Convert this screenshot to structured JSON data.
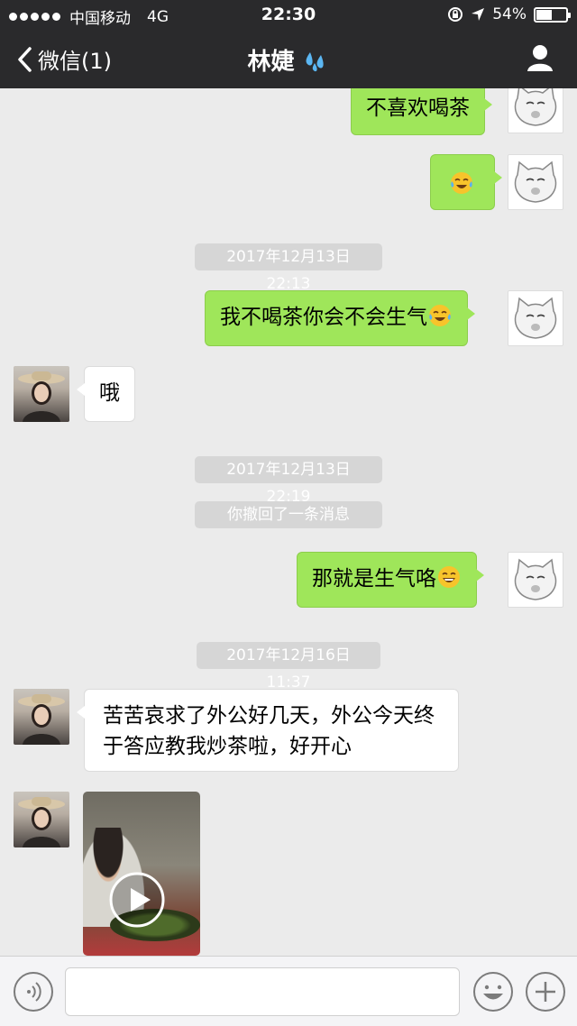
{
  "status_bar": {
    "carrier": "中国移动",
    "network": "4G",
    "time": "22:30",
    "battery": "54%",
    "battery_level": 0.54
  },
  "nav": {
    "back_label": "微信(1)",
    "title": "林婕",
    "title_emoji": "sweat-droplets-icon"
  },
  "messages": [
    {
      "type": "text",
      "from": "me",
      "text": "不喜欢喝茶"
    },
    {
      "type": "emoji",
      "from": "me",
      "emoji": "tears-of-joy-emoji"
    },
    {
      "type": "timestamp",
      "text": "2017年12月13日 22:13"
    },
    {
      "type": "text",
      "from": "me",
      "text": "我不喝茶你会不会生气",
      "emoji": "tears-of-joy-emoji"
    },
    {
      "type": "text",
      "from": "her",
      "text": "哦"
    },
    {
      "type": "timestamp",
      "text": "2017年12月13日 22:19"
    },
    {
      "type": "system",
      "text": "你撤回了一条消息"
    },
    {
      "type": "text",
      "from": "me",
      "text": "那就是生气咯",
      "emoji": "grinning-emoji"
    },
    {
      "type": "timestamp",
      "text": "2017年12月16日 11:37"
    },
    {
      "type": "text",
      "from": "her",
      "text": "苦苦哀求了外公好几天，外公今天终于答应教我炒茶啦，好开心"
    },
    {
      "type": "video",
      "from": "her"
    }
  ],
  "input_bar": {
    "voice_icon": "voice-icon",
    "emoji_icon": "emoji-face-icon",
    "more_icon": "plus-icon"
  },
  "colors": {
    "bar": "#2a2a2c",
    "my_bubble": "#9fe65a",
    "her_bubble": "#ffffff",
    "background": "#ebebeb",
    "timestamp_bg": "#d6d6d6"
  }
}
